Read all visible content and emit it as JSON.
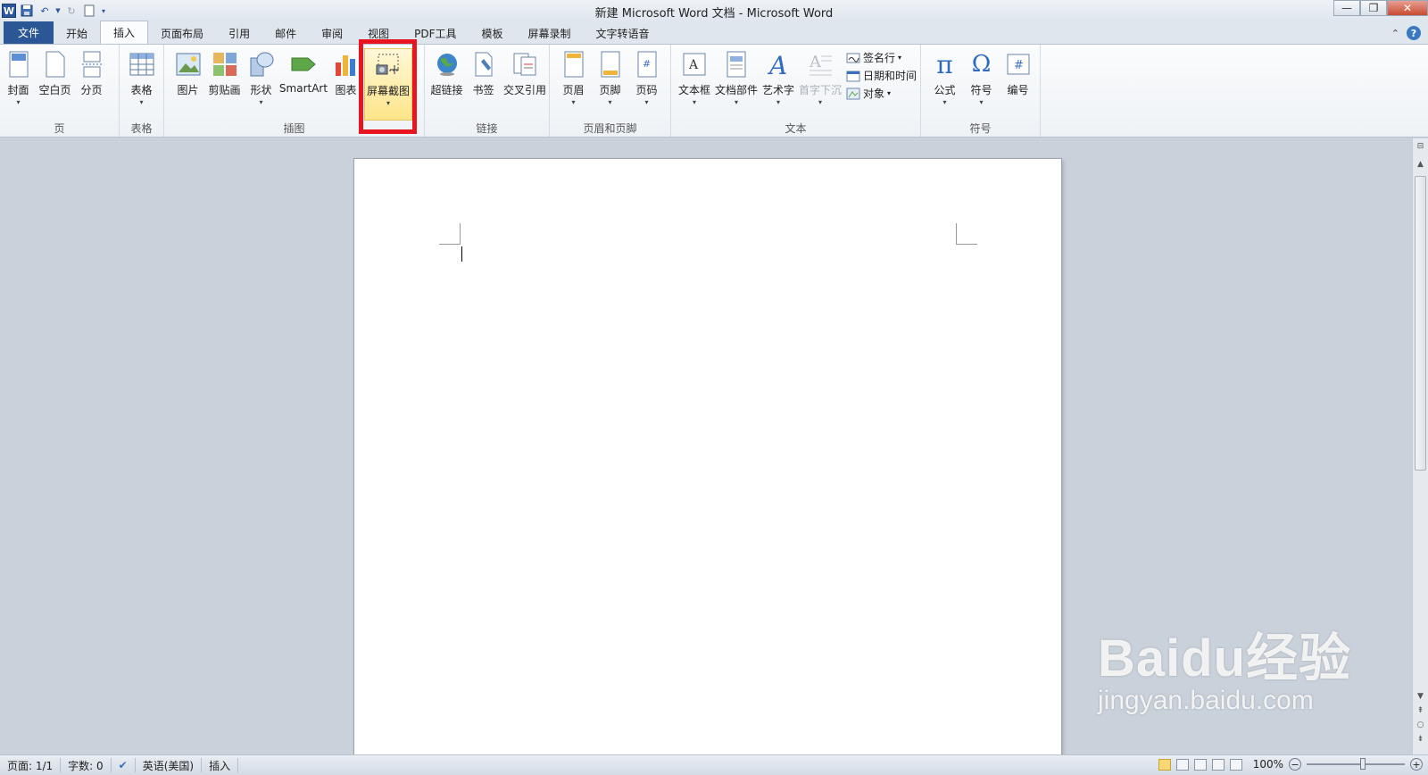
{
  "titlebar": {
    "title": "新建 Microsoft Word 文档 - Microsoft Word",
    "app_icon_letter": "W"
  },
  "tabs": [
    {
      "label": "文件"
    },
    {
      "label": "开始"
    },
    {
      "label": "插入"
    },
    {
      "label": "页面布局"
    },
    {
      "label": "引用"
    },
    {
      "label": "邮件"
    },
    {
      "label": "审阅"
    },
    {
      "label": "视图"
    },
    {
      "label": "PDF工具"
    },
    {
      "label": "模板"
    },
    {
      "label": "屏幕录制"
    },
    {
      "label": "文字转语音"
    }
  ],
  "ribbon": {
    "groups": {
      "page": {
        "label": "页",
        "buttons": [
          "封面",
          "空白页",
          "分页"
        ]
      },
      "table": {
        "label": "表格",
        "buttons": [
          "表格"
        ]
      },
      "illustrations": {
        "label": "插图",
        "buttons": [
          "图片",
          "剪贴画",
          "形状",
          "SmartArt",
          "图表",
          "屏幕截图"
        ]
      },
      "links": {
        "label": "链接",
        "buttons": [
          "超链接",
          "书签",
          "交叉引用"
        ]
      },
      "header_footer": {
        "label": "页眉和页脚",
        "buttons": [
          "页眉",
          "页脚",
          "页码"
        ]
      },
      "text": {
        "label": "文本",
        "buttons": [
          "文本框",
          "文档部件",
          "艺术字",
          "首字下沉"
        ],
        "small_buttons": [
          "签名行",
          "日期和时间",
          "对象"
        ]
      },
      "symbols": {
        "label": "符号",
        "buttons": [
          "公式",
          "符号",
          "编号"
        ]
      }
    }
  },
  "statusbar": {
    "page": "页面: 1/1",
    "words": "字数: 0",
    "language": "英语(美国)",
    "mode": "插入",
    "zoom": "100%"
  },
  "watermark": {
    "big": "Baidu经验",
    "small": "jingyan.baidu.com"
  }
}
